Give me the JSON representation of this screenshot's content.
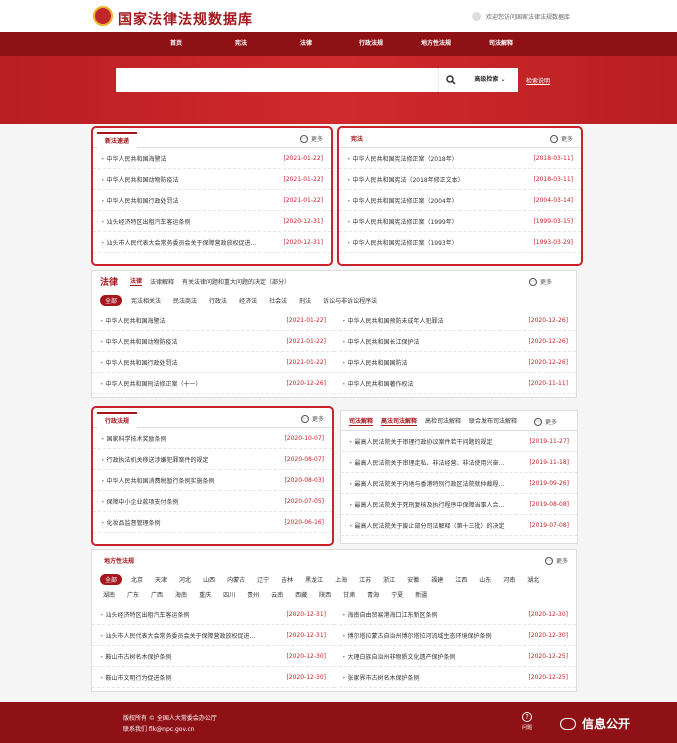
{
  "header": {
    "title": "国家法律法规数据库",
    "welcome": "欢迎您访问国家法律法规数据库"
  },
  "nav": [
    "首页",
    "宪法",
    "法律",
    "行政法规",
    "地方性法规",
    "司法解释"
  ],
  "search": {
    "placeholder": "",
    "advanced": "高级检索",
    "help": "检索说明"
  },
  "more_label": "更多",
  "p1": {
    "title": "新法速递",
    "items": [
      {
        "t": "中华人民共和国海警法",
        "d": "[2021-01-22]"
      },
      {
        "t": "中华人民共和国动物防疫法",
        "d": "[2021-01-22]"
      },
      {
        "t": "中华人民共和国行政处罚法",
        "d": "[2021-01-22]"
      },
      {
        "t": "汕头经济特区出租汽车客运条例",
        "d": "[2020-12-31]"
      },
      {
        "t": "汕头市人民代表大会常务委员会关于保障营政放权促进…",
        "d": "[2020-12-31]"
      }
    ]
  },
  "p2": {
    "title": "宪法",
    "items": [
      {
        "t": "中华人民共和国宪法修正案（2018年）",
        "d": "[2018-03-11]"
      },
      {
        "t": "中华人民共和国宪法（2018年修正文本）",
        "d": "[2018-03-11]"
      },
      {
        "t": "中华人民共和国宪法修正案（2004年）",
        "d": "[2004-03-14]"
      },
      {
        "t": "中华人民共和国宪法修正案（1999年）",
        "d": "[1999-03-15]"
      },
      {
        "t": "中华人民共和国宪法修正案（1993年）",
        "d": "[1993-03-29]"
      }
    ]
  },
  "p3": {
    "big": "法律",
    "tabs": [
      "法律",
      "法律解释",
      "有关法律问题和重大问题的决定（部分）"
    ],
    "filters": [
      "全部",
      "宪法相关法",
      "民法商法",
      "行政法",
      "经济法",
      "社会法",
      "刑法",
      "诉讼与非诉讼程序法"
    ],
    "left": [
      {
        "t": "中华人民共和国海警法",
        "d": "[2021-01-22]"
      },
      {
        "t": "中华人民共和国动物防疫法",
        "d": "[2021-01-22]"
      },
      {
        "t": "中华人民共和国行政处罚法",
        "d": "[2021-01-22]"
      },
      {
        "t": "中华人民共和国刑法修正案（十一）",
        "d": "[2020-12-26]"
      }
    ],
    "right": [
      {
        "t": "中华人民共和国预防未成年人犯罪法",
        "d": "[2020-12-26]"
      },
      {
        "t": "中华人民共和国长江保护法",
        "d": "[2020-12-26]"
      },
      {
        "t": "中华人民共和国国防法",
        "d": "[2020-12-26]"
      },
      {
        "t": "中华人民共和国著作权法",
        "d": "[2020-11-11]"
      }
    ]
  },
  "p4": {
    "title": "行政法规",
    "items": [
      {
        "t": "国家科学技术奖励条例",
        "d": "[2020-10-07]"
      },
      {
        "t": "行政执法机关移送涉嫌犯罪案件的规定",
        "d": "[2020-08-07]"
      },
      {
        "t": "中华人民共和国消费税暂行条例实施条例",
        "d": "[2020-08-03]"
      },
      {
        "t": "保障中小企业款项支付条例",
        "d": "[2020-07-05]"
      },
      {
        "t": "化妆品监督管理条例",
        "d": "[2020-06-16]"
      }
    ]
  },
  "p5": {
    "tabs": [
      "司法解释",
      "高法司法解释",
      "高检司法解释",
      "联合发布司法解释"
    ],
    "items": [
      {
        "t": "最高人民法院关于审理行政协议案件若干问题的规定",
        "d": "[2019-11-27]"
      },
      {
        "t": "最高人民法院关于审理走私、非法经营、非法使用兴奋…",
        "d": "[2019-11-18]"
      },
      {
        "t": "最高人民法院关于内地与香港特别行政区法院就仲裁程…",
        "d": "[2019-09-26]"
      },
      {
        "t": "最高人民法院关于死刑复核及执行程序中保障当事人合…",
        "d": "[2019-08-08]"
      },
      {
        "t": "最高人民法院关于废止部分司法解释（第十三批）的决定",
        "d": "[2019-07-08]"
      }
    ]
  },
  "p6": {
    "title": "地方性法规",
    "regions": [
      "全部",
      "北京",
      "天津",
      "河北",
      "山西",
      "内蒙古",
      "辽宁",
      "吉林",
      "黑龙江",
      "上海",
      "江苏",
      "浙江",
      "安徽",
      "福建",
      "江西",
      "山东",
      "河南",
      "湖北",
      "湖南",
      "广东",
      "广西",
      "海南",
      "重庆",
      "四川",
      "贵州",
      "云南",
      "西藏",
      "陕西",
      "甘肃",
      "青海",
      "宁夏",
      "新疆"
    ],
    "left": [
      {
        "t": "汕头经济特区出租汽车客运条例",
        "d": "[2020-12-31]"
      },
      {
        "t": "汕头市人民代表大会常务委员会关于保障营政放权促进…",
        "d": "[2020-12-31]"
      },
      {
        "t": "鞍山市古树名木保护条例",
        "d": "[2020-12-30]"
      },
      {
        "t": "鞍山市文明行为促进条例",
        "d": "[2020-12-30]"
      }
    ],
    "right": [
      {
        "t": "海南自由贸易港海口江东新区条例",
        "d": "[2020-12-30]"
      },
      {
        "t": "博尔塔拉蒙古自治州博尔塔拉河流域生态环境保护条例",
        "d": "[2020-12-30]"
      },
      {
        "t": "大理白族自治州非物质文化遗产保护条例",
        "d": "[2020-12-25]"
      },
      {
        "t": "张家界市古树名木保护条例",
        "d": "[2020-12-25]"
      }
    ]
  },
  "footer": {
    "copyright": "版权所有 © 全国人大常委会办公厅",
    "contact": "联系我们 flk@npc.gov.cn",
    "help": "问题",
    "wechat": "信息公开"
  }
}
